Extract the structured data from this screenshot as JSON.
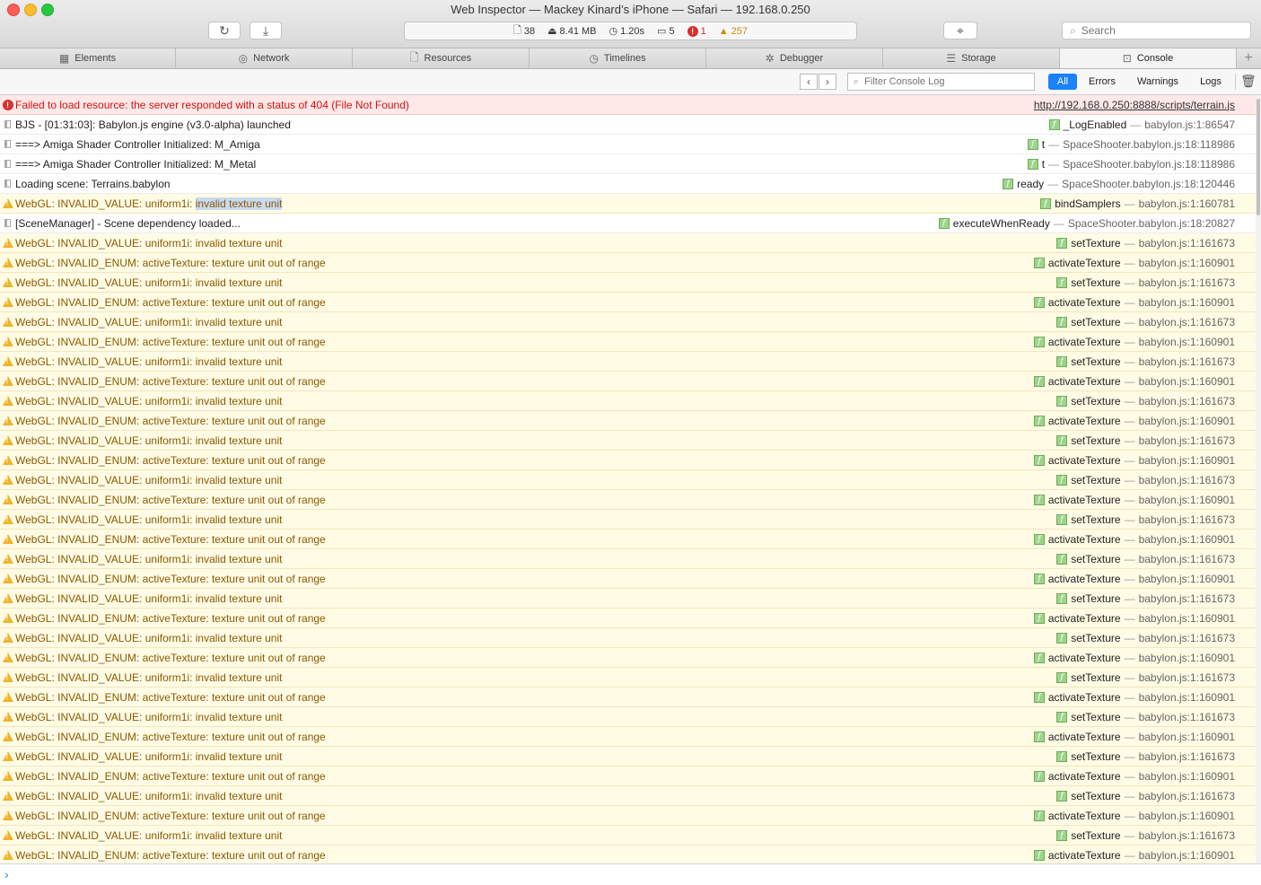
{
  "window": {
    "title": "Web Inspector — Mackey Kinard’s iPhone — Safari — 192.168.0.250"
  },
  "toolbar": {
    "resources_count": "38",
    "size": "8.41 MB",
    "load_time": "1.20s",
    "logs_count": "5",
    "errors_count": "1",
    "warnings_count": "257",
    "search_placeholder": "Search"
  },
  "tabs": [
    {
      "label": "Elements",
      "icon": "elements-icon"
    },
    {
      "label": "Network",
      "icon": "network-icon"
    },
    {
      "label": "Resources",
      "icon": "resources-icon"
    },
    {
      "label": "Timelines",
      "icon": "timelines-icon"
    },
    {
      "label": "Debugger",
      "icon": "debugger-icon"
    },
    {
      "label": "Storage",
      "icon": "storage-icon"
    },
    {
      "label": "Console",
      "icon": "console-icon",
      "active": true
    }
  ],
  "console_filter": {
    "placeholder": "Filter Console Log",
    "levels": [
      "All",
      "Errors",
      "Warnings",
      "Logs"
    ],
    "selected": "All"
  },
  "messages": [
    {
      "type": "error",
      "text": "Failed to load resource: the server responded with a status of 404 (File Not Found)",
      "url": "http://192.168.0.250:8888/scripts/terrain.js"
    },
    {
      "type": "log",
      "text": "BJS - [01:31:03]: Babylon.js engine (v3.0-alpha) launched",
      "fn": "_LogEnabled",
      "loc": "babylon.js:1:86547"
    },
    {
      "type": "log",
      "text": "===> Amiga Shader Controller Initialized: M_Amiga",
      "fn": "t",
      "loc": "SpaceShooter.babylon.js:18:118986"
    },
    {
      "type": "log",
      "text": "===> Amiga Shader Controller Initialized: M_Metal",
      "fn": "t",
      "loc": "SpaceShooter.babylon.js:18:118986"
    },
    {
      "type": "log",
      "text": "Loading scene: Terrains.babylon",
      "fn": "ready",
      "loc": "SpaceShooter.babylon.js:18:120446"
    },
    {
      "type": "warn",
      "text": "WebGL: INVALID_VALUE: uniform1i: ",
      "highlight": "invalid texture unit",
      "fn": "bindSamplers",
      "loc": "babylon.js:1:160781"
    },
    {
      "type": "log",
      "text": "[SceneManager] - Scene dependency loaded...",
      "fn": "executeWhenReady",
      "loc": "SpaceShooter.babylon.js:18:20827"
    },
    {
      "type": "warn",
      "text": "WebGL: INVALID_VALUE: uniform1i: invalid texture unit",
      "fn": "setTexture",
      "loc": "babylon.js:1:161673"
    },
    {
      "type": "warn",
      "text": "WebGL: INVALID_ENUM: activeTexture: texture unit out of range",
      "fn": "activateTexture",
      "loc": "babylon.js:1:160901"
    },
    {
      "type": "warn",
      "text": "WebGL: INVALID_VALUE: uniform1i: invalid texture unit",
      "fn": "setTexture",
      "loc": "babylon.js:1:161673"
    },
    {
      "type": "warn",
      "text": "WebGL: INVALID_ENUM: activeTexture: texture unit out of range",
      "fn": "activateTexture",
      "loc": "babylon.js:1:160901"
    },
    {
      "type": "warn",
      "text": "WebGL: INVALID_VALUE: uniform1i: invalid texture unit",
      "fn": "setTexture",
      "loc": "babylon.js:1:161673"
    },
    {
      "type": "warn",
      "text": "WebGL: INVALID_ENUM: activeTexture: texture unit out of range",
      "fn": "activateTexture",
      "loc": "babylon.js:1:160901"
    },
    {
      "type": "warn",
      "text": "WebGL: INVALID_VALUE: uniform1i: invalid texture unit",
      "fn": "setTexture",
      "loc": "babylon.js:1:161673"
    },
    {
      "type": "warn",
      "text": "WebGL: INVALID_ENUM: activeTexture: texture unit out of range",
      "fn": "activateTexture",
      "loc": "babylon.js:1:160901"
    },
    {
      "type": "warn",
      "text": "WebGL: INVALID_VALUE: uniform1i: invalid texture unit",
      "fn": "setTexture",
      "loc": "babylon.js:1:161673"
    },
    {
      "type": "warn",
      "text": "WebGL: INVALID_ENUM: activeTexture: texture unit out of range",
      "fn": "activateTexture",
      "loc": "babylon.js:1:160901"
    },
    {
      "type": "warn",
      "text": "WebGL: INVALID_VALUE: uniform1i: invalid texture unit",
      "fn": "setTexture",
      "loc": "babylon.js:1:161673"
    },
    {
      "type": "warn",
      "text": "WebGL: INVALID_ENUM: activeTexture: texture unit out of range",
      "fn": "activateTexture",
      "loc": "babylon.js:1:160901"
    },
    {
      "type": "warn",
      "text": "WebGL: INVALID_VALUE: uniform1i: invalid texture unit",
      "fn": "setTexture",
      "loc": "babylon.js:1:161673"
    },
    {
      "type": "warn",
      "text": "WebGL: INVALID_ENUM: activeTexture: texture unit out of range",
      "fn": "activateTexture",
      "loc": "babylon.js:1:160901"
    },
    {
      "type": "warn",
      "text": "WebGL: INVALID_VALUE: uniform1i: invalid texture unit",
      "fn": "setTexture",
      "loc": "babylon.js:1:161673"
    },
    {
      "type": "warn",
      "text": "WebGL: INVALID_ENUM: activeTexture: texture unit out of range",
      "fn": "activateTexture",
      "loc": "babylon.js:1:160901"
    },
    {
      "type": "warn",
      "text": "WebGL: INVALID_VALUE: uniform1i: invalid texture unit",
      "fn": "setTexture",
      "loc": "babylon.js:1:161673"
    },
    {
      "type": "warn",
      "text": "WebGL: INVALID_ENUM: activeTexture: texture unit out of range",
      "fn": "activateTexture",
      "loc": "babylon.js:1:160901"
    },
    {
      "type": "warn",
      "text": "WebGL: INVALID_VALUE: uniform1i: invalid texture unit",
      "fn": "setTexture",
      "loc": "babylon.js:1:161673"
    },
    {
      "type": "warn",
      "text": "WebGL: INVALID_ENUM: activeTexture: texture unit out of range",
      "fn": "activateTexture",
      "loc": "babylon.js:1:160901"
    },
    {
      "type": "warn",
      "text": "WebGL: INVALID_VALUE: uniform1i: invalid texture unit",
      "fn": "setTexture",
      "loc": "babylon.js:1:161673"
    },
    {
      "type": "warn",
      "text": "WebGL: INVALID_ENUM: activeTexture: texture unit out of range",
      "fn": "activateTexture",
      "loc": "babylon.js:1:160901"
    },
    {
      "type": "warn",
      "text": "WebGL: INVALID_VALUE: uniform1i: invalid texture unit",
      "fn": "setTexture",
      "loc": "babylon.js:1:161673"
    },
    {
      "type": "warn",
      "text": "WebGL: INVALID_ENUM: activeTexture: texture unit out of range",
      "fn": "activateTexture",
      "loc": "babylon.js:1:160901"
    },
    {
      "type": "warn",
      "text": "WebGL: INVALID_VALUE: uniform1i: invalid texture unit",
      "fn": "setTexture",
      "loc": "babylon.js:1:161673"
    },
    {
      "type": "warn",
      "text": "WebGL: INVALID_ENUM: activeTexture: texture unit out of range",
      "fn": "activateTexture",
      "loc": "babylon.js:1:160901"
    },
    {
      "type": "warn",
      "text": "WebGL: INVALID_VALUE: uniform1i: invalid texture unit",
      "fn": "setTexture",
      "loc": "babylon.js:1:161673"
    },
    {
      "type": "warn",
      "text": "WebGL: INVALID_ENUM: activeTexture: texture unit out of range",
      "fn": "activateTexture",
      "loc": "babylon.js:1:160901"
    },
    {
      "type": "warn",
      "text": "WebGL: INVALID_VALUE: uniform1i: invalid texture unit",
      "fn": "setTexture",
      "loc": "babylon.js:1:161673"
    },
    {
      "type": "warn",
      "text": "WebGL: INVALID_ENUM: activeTexture: texture unit out of range",
      "fn": "activateTexture",
      "loc": "babylon.js:1:160901"
    },
    {
      "type": "warn",
      "text": "WebGL: INVALID_VALUE: uniform1i: invalid texture unit",
      "fn": "setTexture",
      "loc": "babylon.js:1:161673"
    },
    {
      "type": "warn",
      "text": "WebGL: INVALID_ENUM: activeTexture: texture unit out of range",
      "fn": "activateTexture",
      "loc": "babylon.js:1:160901"
    }
  ],
  "colors": {
    "selected_filter": "#1a82fb",
    "error_text": "#d21212",
    "warning_text": "#8a5a00",
    "warning_bg": "#fffbe5",
    "error_bg": "#ffe8e8"
  }
}
